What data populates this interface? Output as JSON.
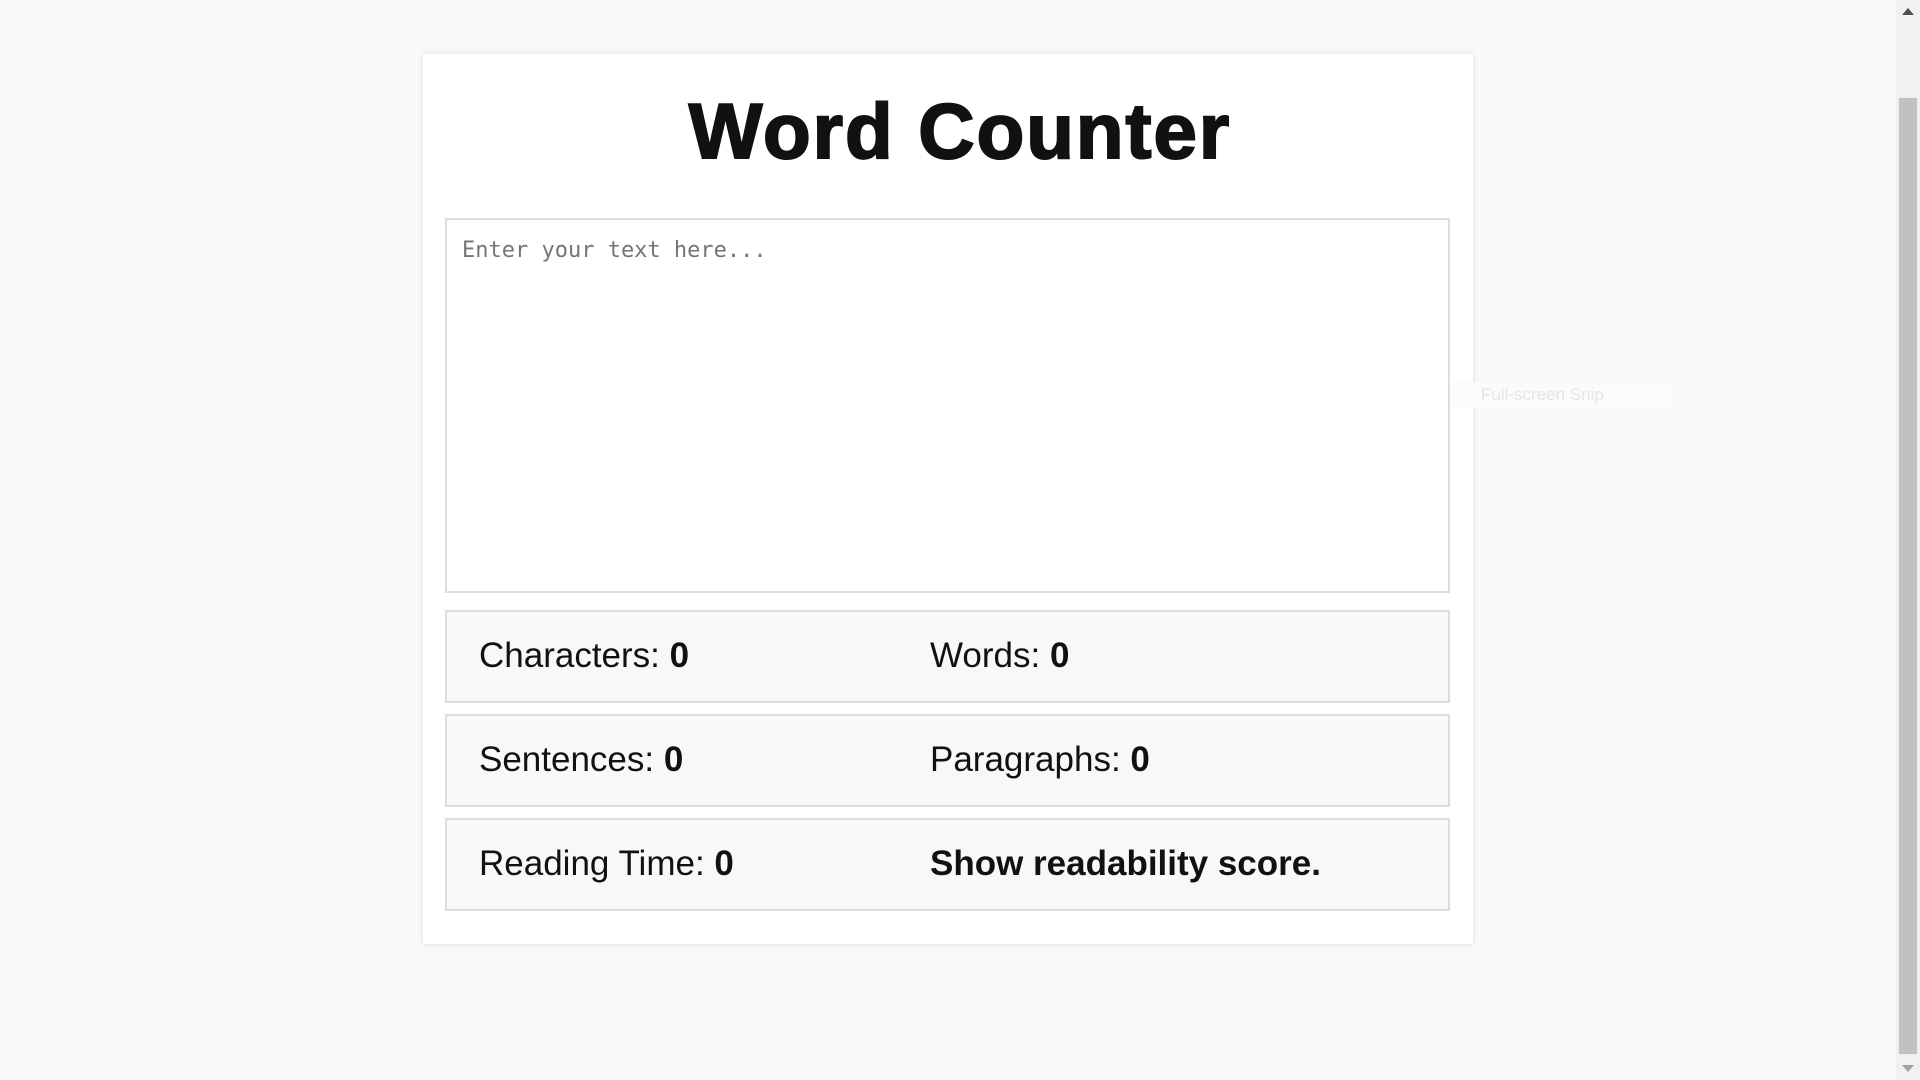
{
  "title": "Word Counter",
  "input": {
    "placeholder": "Enter your text here...",
    "value": ""
  },
  "stats": [
    {
      "label": "Characters: ",
      "value": "0"
    },
    {
      "label": "Words: ",
      "value": "0"
    },
    {
      "label": "Sentences: ",
      "value": "0"
    },
    {
      "label": "Paragraphs: ",
      "value": "0"
    },
    {
      "label": "Reading Time: ",
      "value": "0"
    }
  ],
  "readability_link": "Show readability score.",
  "overlay_tooltip": "Full-screen Snip"
}
